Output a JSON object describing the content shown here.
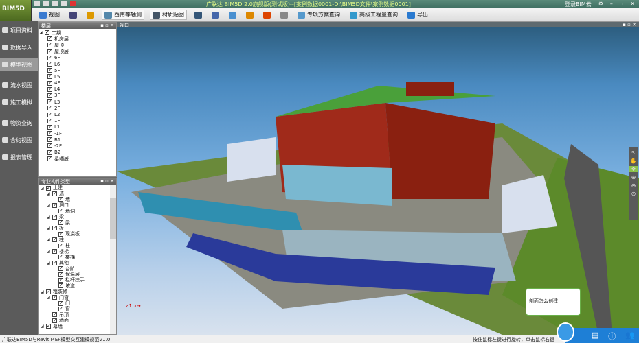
{
  "app": {
    "logo": "BIM5D",
    "title": "广联达 BIM5D 2.0旗舰版(测试版)--[案例数据0001-D:\\BIM5D文件\\案例数据0001]",
    "login": "登录BIM云"
  },
  "toolbar": {
    "items": [
      {
        "label": "视图",
        "icon": "monitor-icon"
      },
      {
        "label": "",
        "icon": "grid-icon"
      },
      {
        "label": "",
        "icon": "crane-icon"
      },
      {
        "label": "西南等轴测",
        "icon": "cube-view-icon"
      },
      {
        "label": "材质贴图",
        "icon": "texture-icon"
      },
      {
        "label": "",
        "icon": "footprint-icon"
      },
      {
        "label": "",
        "icon": "person-icon"
      },
      {
        "label": "",
        "icon": "calendar-icon"
      },
      {
        "label": "",
        "icon": "measure-icon"
      },
      {
        "label": "",
        "icon": "section-icon"
      },
      {
        "label": "",
        "icon": "pen-icon"
      },
      {
        "label": "专项方案查询",
        "icon": "search-doc-icon"
      },
      {
        "label": "高级工程量查询",
        "icon": "quantity-icon"
      },
      {
        "label": "导出",
        "icon": "export-icon"
      }
    ]
  },
  "nav": {
    "items": [
      {
        "label": "项目资料"
      },
      {
        "label": "数据导入"
      },
      {
        "label": "模型视图",
        "active": true
      },
      {
        "label": "流水视图"
      },
      {
        "label": "施工模拟"
      },
      {
        "label": "物资查询"
      },
      {
        "label": "合约视图"
      },
      {
        "label": "报表管理"
      }
    ]
  },
  "floors": {
    "title": "楼层",
    "root": "二期",
    "items": [
      "机房层",
      "屋顶",
      "屋顶层",
      "6F",
      "L6",
      "5F",
      "L5",
      "4F",
      "L4",
      "3F",
      "L3",
      "2F",
      "L2",
      "1F",
      "L1",
      "-1F",
      "B1",
      "-2F",
      "B2",
      "基础层"
    ]
  },
  "types": {
    "title": "专业构件类型",
    "items": [
      {
        "label": "土建",
        "level": 0,
        "expand": true
      },
      {
        "label": "墙",
        "level": 1,
        "expand": true
      },
      {
        "label": "墙",
        "level": 2
      },
      {
        "label": "洞口",
        "level": 1,
        "expand": true
      },
      {
        "label": "墙洞",
        "level": 2
      },
      {
        "label": "梁",
        "level": 1,
        "expand": true
      },
      {
        "label": "梁",
        "level": 2
      },
      {
        "label": "板",
        "level": 1,
        "expand": true
      },
      {
        "label": "现浇板",
        "level": 2
      },
      {
        "label": "柱",
        "level": 1,
        "expand": true
      },
      {
        "label": "柱",
        "level": 2
      },
      {
        "label": "楼梯",
        "level": 1,
        "expand": true
      },
      {
        "label": "楼梯",
        "level": 2
      },
      {
        "label": "其他",
        "level": 1,
        "expand": true
      },
      {
        "label": "台阶",
        "level": 2
      },
      {
        "label": "保温层",
        "level": 2
      },
      {
        "label": "栏杆扶手",
        "level": 2
      },
      {
        "label": "坡道",
        "level": 2
      },
      {
        "label": "粗装修",
        "level": 0,
        "expand": true
      },
      {
        "label": "门窗",
        "level": 1,
        "expand": true
      },
      {
        "label": "门",
        "level": 2
      },
      {
        "label": "窗",
        "level": 2
      },
      {
        "label": "吊顶",
        "level": 1
      },
      {
        "label": "墙面",
        "level": 1
      },
      {
        "label": "幕墙",
        "level": 0,
        "expand": true
      }
    ]
  },
  "viewport": {
    "title": "视口"
  },
  "help": {
    "bubble": "剖面怎么创建"
  },
  "status": {
    "left": "广联达BIM5D与Revit MEP模型交互建模规范V1.0",
    "right": "按住鼠标左键进行旋转，单击鼠标右键"
  }
}
